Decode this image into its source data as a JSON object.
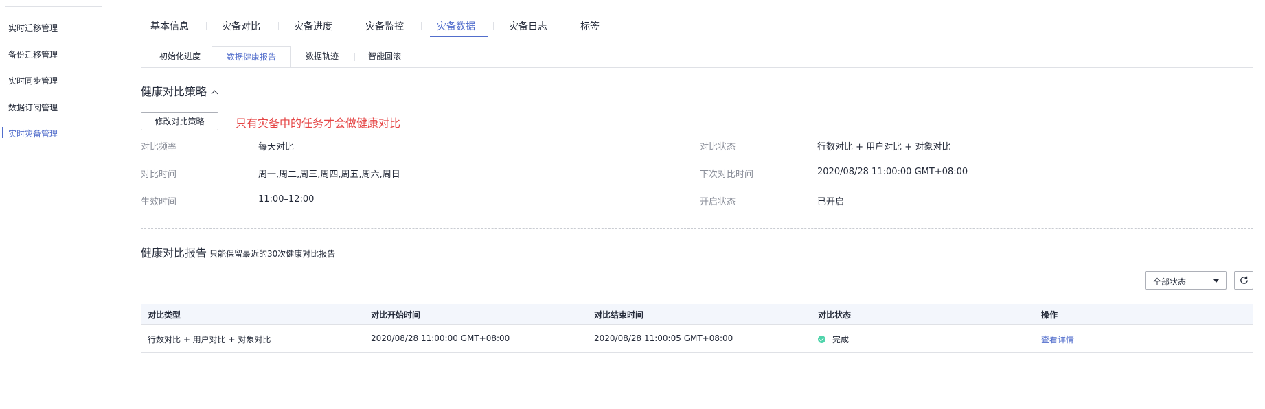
{
  "sidebar": {
    "items": [
      {
        "label": "实时迁移管理",
        "active": false
      },
      {
        "label": "备份迁移管理",
        "active": false
      },
      {
        "label": "实时同步管理",
        "active": false
      },
      {
        "label": "数据订阅管理",
        "active": false
      },
      {
        "label": "实时灾备管理",
        "active": true
      }
    ]
  },
  "tabs": {
    "primary": [
      "基本信息",
      "灾备对比",
      "灾备进度",
      "灾备监控",
      "灾备数据",
      "灾备日志",
      "标签"
    ],
    "primary_active": "灾备数据",
    "secondary": [
      "初始化进度",
      "数据健康报告",
      "数据轨迹",
      "智能回滚"
    ],
    "secondary_active": "数据健康报告"
  },
  "strategy": {
    "title": "健康对比策略",
    "edit_button": "修改对比策略",
    "warning": "只有灾备中的任务才会做健康对比",
    "fields": [
      {
        "label": "对比频率",
        "value": "每天对比"
      },
      {
        "label": "对比时间",
        "value": "周一,周二,周三,周四,周五,周六,周日"
      },
      {
        "label": "生效时间",
        "value": "11:00–12:00"
      },
      {
        "label": "对比状态",
        "value": "行数对比 + 用户对比 + 对象对比"
      },
      {
        "label": "下次对比时间",
        "value": "2020/08/28 11:00:00 GMT+08:00"
      },
      {
        "label": "开启状态",
        "value": "已开启"
      }
    ]
  },
  "report": {
    "title": "健康对比报告",
    "note": "只能保留最近的30次健康对比报告",
    "filter_value": "全部状态",
    "columns": [
      "对比类型",
      "对比开始时间",
      "对比结束时间",
      "对比状态",
      "操作"
    ],
    "rows": [
      {
        "type": "行数对比 + 用户对比 + 对象对比",
        "start": "2020/08/28 11:00:00 GMT+08:00",
        "end": "2020/08/28 11:00:05 GMT+08:00",
        "status": "完成",
        "action": "查看详情"
      }
    ]
  },
  "colors": {
    "accent": "#526ecc",
    "warning": "#e54545",
    "success": "#50d4ab"
  }
}
